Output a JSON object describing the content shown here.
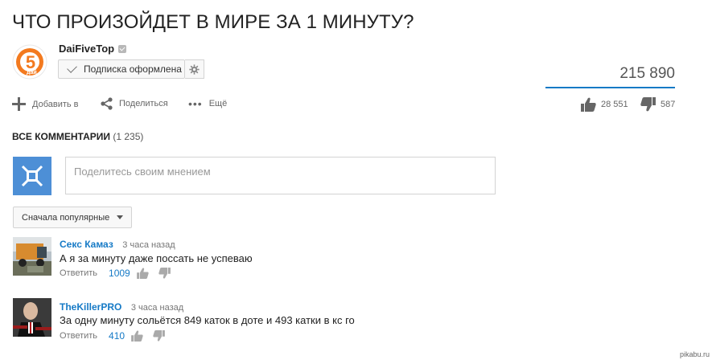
{
  "video": {
    "title": "ЧТО ПРОИЗОЙДЕТ В МИРЕ ЗА 1 МИНУТУ?",
    "views": "215 890"
  },
  "channel": {
    "name": "DaiFiveTop",
    "logo_text": "5",
    "logo_sub": "дай",
    "subscribe_label": "Подписка оформлена"
  },
  "actions": {
    "add_label": "Добавить в",
    "share_label": "Поделиться",
    "more_label": "Ещё",
    "likes": "28 551",
    "dislikes": "587"
  },
  "comments_section": {
    "heading": "ВСЕ КОММЕНТАРИИ",
    "count": "(1 235)",
    "input_placeholder": "Поделитесь своим мнением",
    "sort_label": "Сначала популярные"
  },
  "comments": [
    {
      "author": "Секс Камаз",
      "time": "3 часа назад",
      "text": "А я за минуту даже поссать не успеваю",
      "reply_label": "Ответить",
      "likes": "1009"
    },
    {
      "author": "TheKillerPRO",
      "time": "3 часа назад",
      "text": "За одну минуту сольётся 849 каток в доте и 493 катки в кс го",
      "reply_label": "Ответить",
      "likes": "410"
    }
  ],
  "watermark": "pikabu.ru",
  "colors": {
    "link_blue": "#167ac6",
    "logo_orange": "#f37a1f",
    "avatar_blue": "#4d8fd6"
  }
}
